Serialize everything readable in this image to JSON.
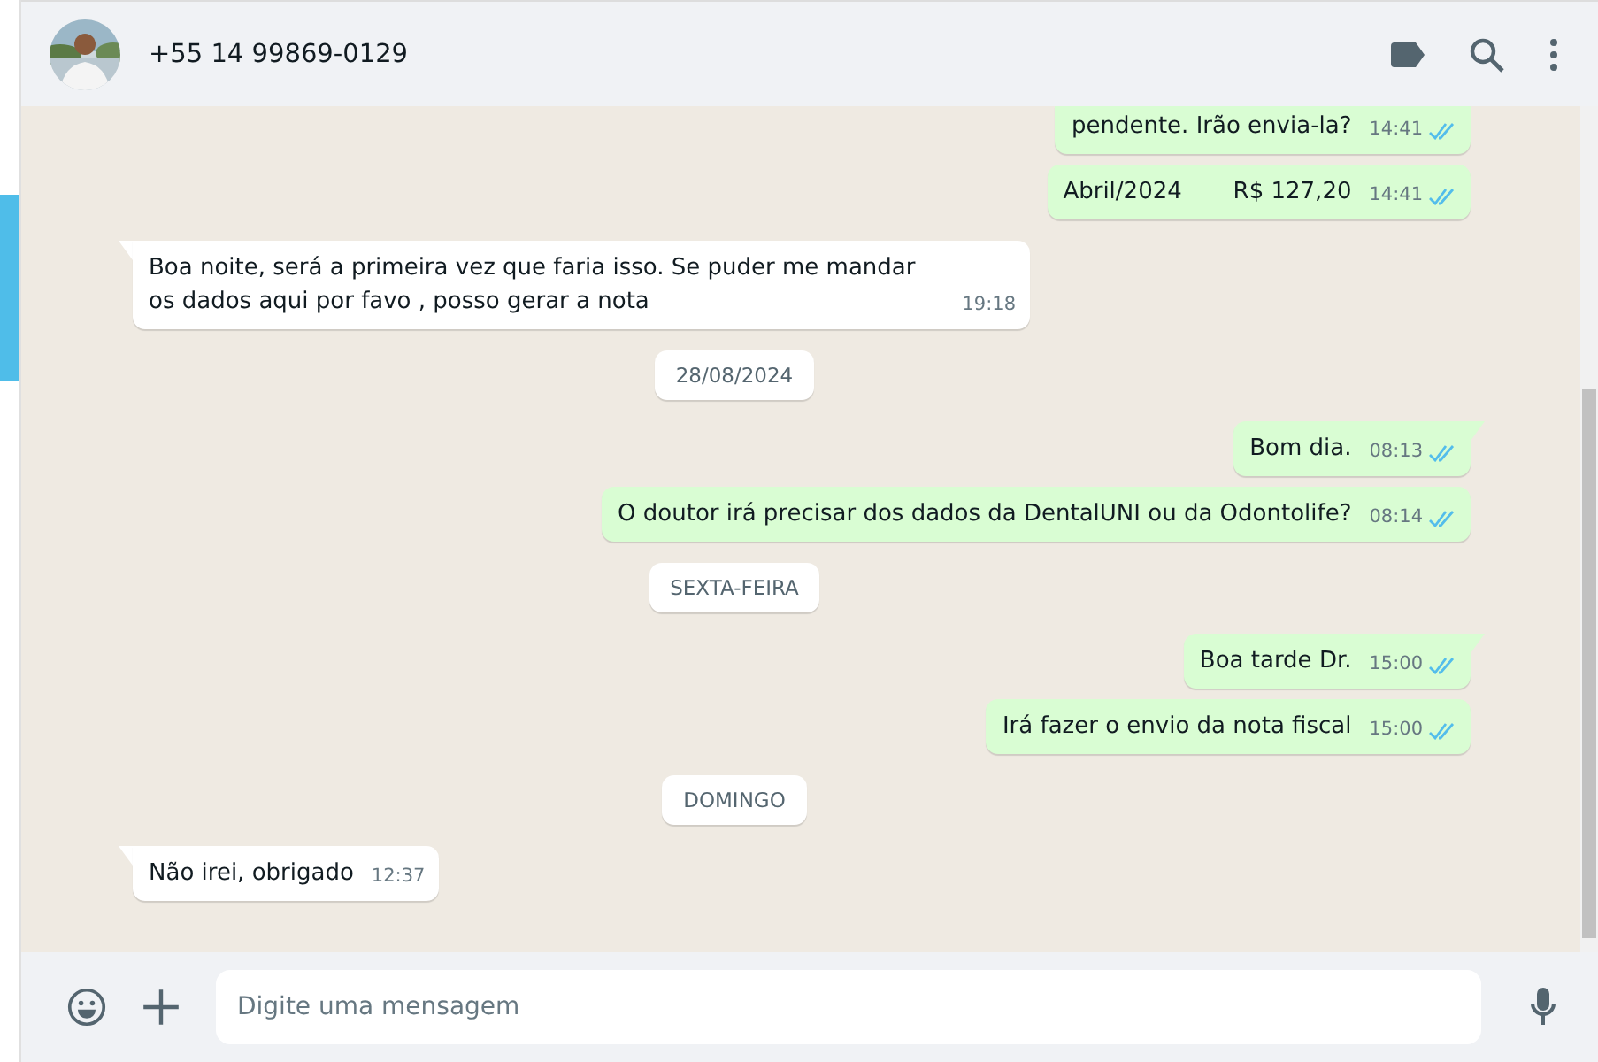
{
  "header": {
    "contact": "+55 14 99869-0129"
  },
  "messages": [
    {
      "kind": "out",
      "text": "pendente. Irão envia-la?",
      "time": "14:41",
      "read": true,
      "tail": false
    },
    {
      "kind": "out",
      "text": "Abril/2024       R$ 127,20",
      "time": "14:41",
      "read": true,
      "tail": false
    },
    {
      "kind": "in",
      "text": "Boa noite, será a primeira vez que faria isso. Se puder me mandar os dados aqui por favo , posso gerar a nota",
      "time": "19:18",
      "tail": true
    },
    {
      "kind": "date",
      "text": "28/08/2024"
    },
    {
      "kind": "out",
      "text": "Bom dia.",
      "time": "08:13",
      "read": true,
      "tail": true
    },
    {
      "kind": "out",
      "text": "O doutor irá precisar dos dados da DentalUNI ou da Odontolife?",
      "time": "08:14",
      "read": true,
      "tail": false
    },
    {
      "kind": "date",
      "text": "SEXTA-FEIRA"
    },
    {
      "kind": "out",
      "text": "Boa tarde Dr.",
      "time": "15:00",
      "read": true,
      "tail": true
    },
    {
      "kind": "out",
      "text": "Irá fazer o envio da nota fiscal",
      "time": "15:00",
      "read": true,
      "tail": false
    },
    {
      "kind": "date",
      "text": "DOMINGO"
    },
    {
      "kind": "in",
      "text": "Não irei, obrigado",
      "time": "12:37",
      "tail": true
    }
  ],
  "composer": {
    "placeholder": "Digite uma mensagem"
  }
}
